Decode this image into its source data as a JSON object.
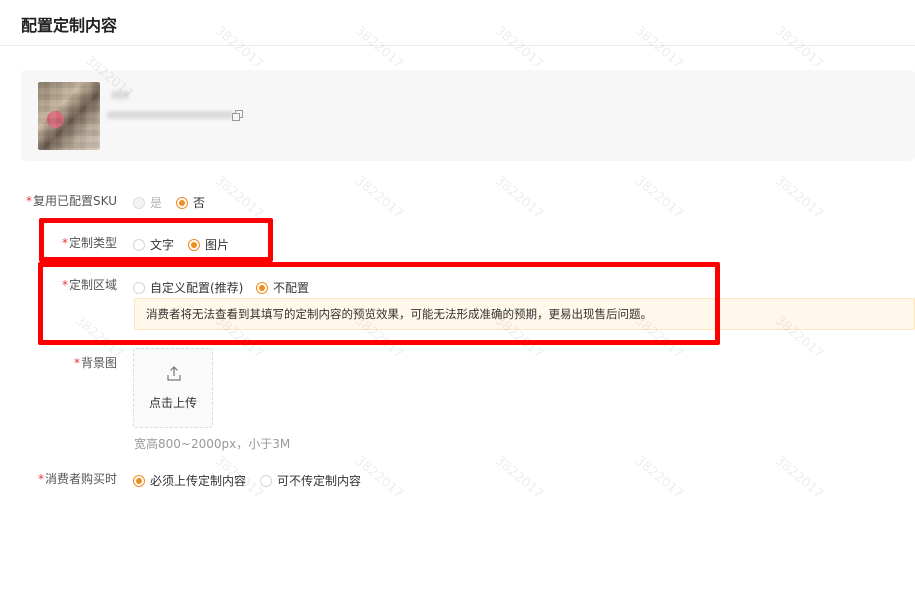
{
  "header": {
    "title": "配置定制内容"
  },
  "product": {
    "image": "product-thumbnail (blurred)",
    "copy_icon": "copy-icon"
  },
  "watermark": "3822017",
  "form": {
    "reuse_sku": {
      "required_mark": "*",
      "label": "复用已配置SKU",
      "options": [
        {
          "label": "是",
          "checked": false,
          "disabled": true
        },
        {
          "label": "否",
          "checked": true,
          "disabled": false
        }
      ]
    },
    "custom_type": {
      "required_mark": "*",
      "label": "定制类型",
      "options": [
        {
          "label": "文字",
          "checked": false
        },
        {
          "label": "图片",
          "checked": true
        }
      ]
    },
    "custom_area": {
      "required_mark": "*",
      "label": "定制区域",
      "options": [
        {
          "label": "自定义配置(推荐)",
          "checked": false
        },
        {
          "label": "不配置",
          "checked": true
        }
      ],
      "warning": "消费者将无法查看到其填写的定制内容的预览效果，可能无法形成准确的预期，更易出现售后问题。"
    },
    "background": {
      "required_mark": "*",
      "label": "背景图",
      "upload_label": "点击上传",
      "upload_icon": "upload-icon",
      "hint": "宽高800~2000px，小于3M"
    },
    "buyer_upload": {
      "required_mark": "*",
      "label": "消费者购买时",
      "options": [
        {
          "label": "必须上传定制内容",
          "checked": true
        },
        {
          "label": "可不传定制内容",
          "checked": false
        }
      ]
    }
  },
  "colors": {
    "accent": "#f08c1e",
    "required": "#e4393c",
    "highlight": "#ff0000",
    "warning_bg": "#fff8eb"
  }
}
